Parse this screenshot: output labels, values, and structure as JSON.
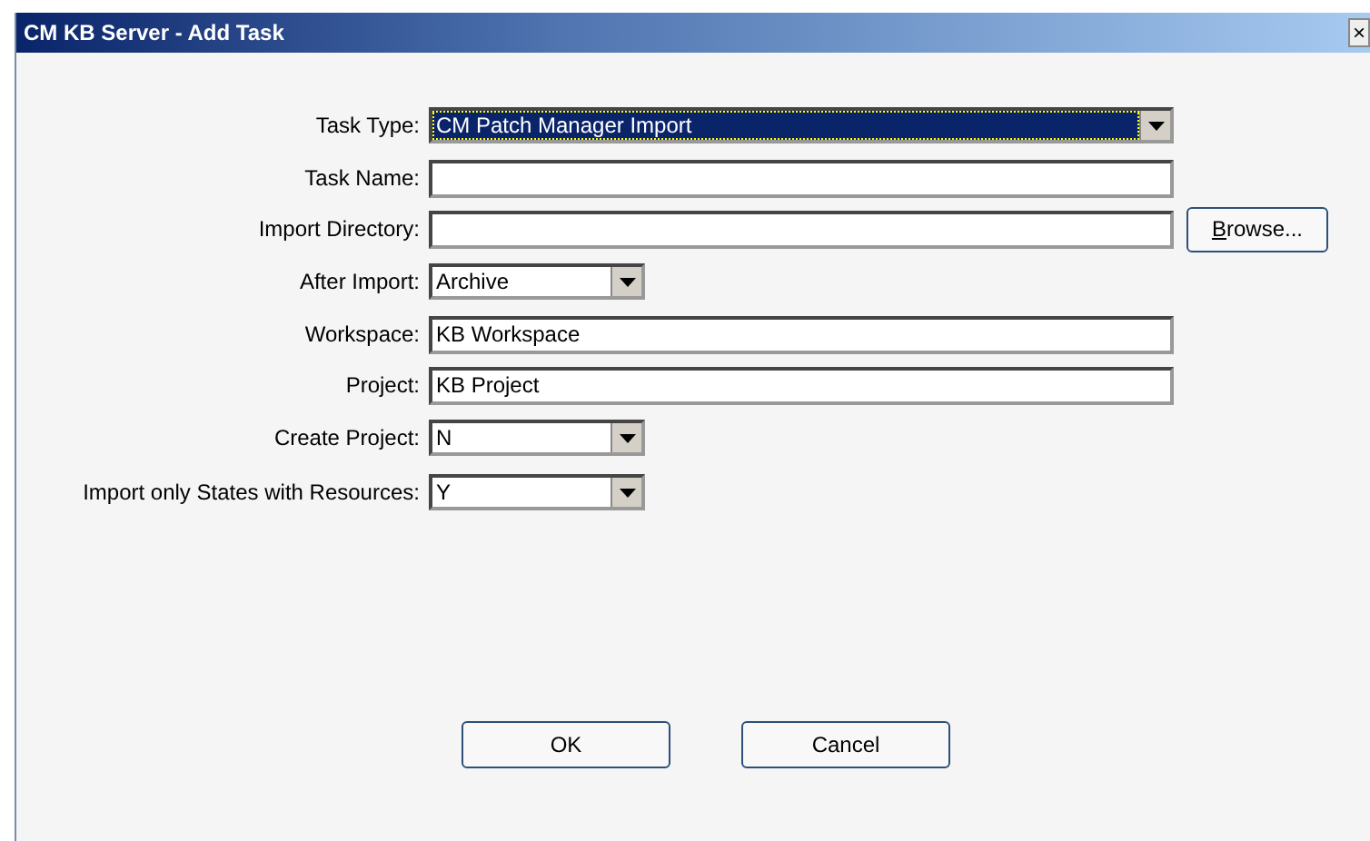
{
  "window": {
    "title": "CM KB Server - Add Task",
    "close": "×"
  },
  "fields": [
    {
      "label": "Task Type:",
      "kind": "wide-combo",
      "value": "CM Patch Manager Import",
      "highlighted": true
    },
    {
      "label": "Task Name:",
      "kind": "text",
      "highlighted": false
    },
    {
      "label": "Import Directory:",
      "kind": "text",
      "highlighted": false,
      "button": "Browse..."
    },
    {
      "label": "After Import:",
      "kind": "combo",
      "value": "Archive",
      "highlighted": false
    },
    {
      "label": "Workspace:",
      "kind": "text",
      "value": "KB Workspace",
      "highlighted": false
    },
    {
      "label": "Project:",
      "kind": "text",
      "value": "KB Project",
      "highlighted": false
    },
    {
      "label": "Create Project:",
      "kind": "combo",
      "value": "N",
      "highlighted": false
    },
    {
      "label": "Import only States with Resources:",
      "kind": "combo",
      "value": "Y",
      "highlighted": false
    }
  ],
  "buttons": [
    "OK",
    "Cancel"
  ]
}
